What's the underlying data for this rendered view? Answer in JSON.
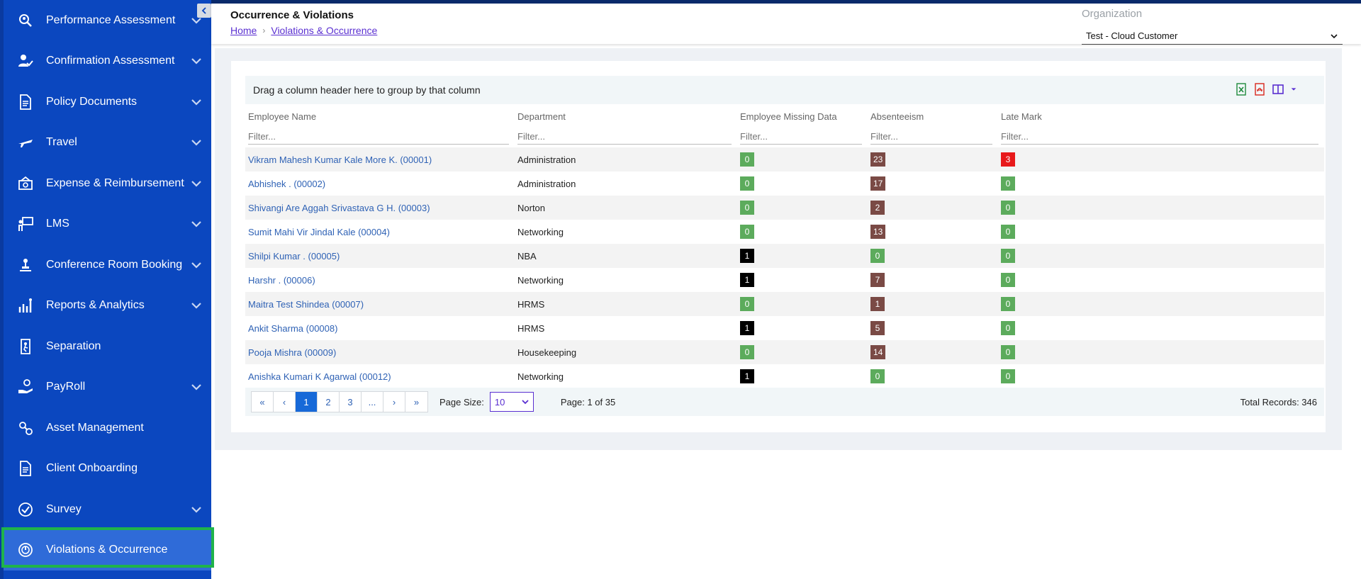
{
  "sidebar": {
    "items": [
      {
        "label": "Performance Assessment",
        "icon": "magnifier-user-icon",
        "chevron": true
      },
      {
        "label": "Confirmation Assessment",
        "icon": "user-check-icon",
        "chevron": true
      },
      {
        "label": "Policy Documents",
        "icon": "document-icon",
        "chevron": true
      },
      {
        "label": "Travel",
        "icon": "airplane-icon",
        "chevron": true
      },
      {
        "label": "Expense & Reimbursement",
        "icon": "money-icon",
        "chevron": true
      },
      {
        "label": "LMS",
        "icon": "teacher-board-icon",
        "chevron": true
      },
      {
        "label": "Conference Room Booking",
        "icon": "conference-icon",
        "chevron": true
      },
      {
        "label": "Reports & Analytics",
        "icon": "analytics-icon",
        "chevron": true
      },
      {
        "label": "Separation",
        "icon": "exit-door-icon",
        "chevron": false
      },
      {
        "label": "PayRoll",
        "icon": "hand-coin-icon",
        "chevron": true
      },
      {
        "label": "Asset Management",
        "icon": "asset-icon",
        "chevron": false
      },
      {
        "label": "Client Onboarding",
        "icon": "document-icon",
        "chevron": false
      },
      {
        "label": "Survey",
        "icon": "check-circle-icon",
        "chevron": true
      },
      {
        "label": "Violations & Occurrence",
        "icon": "violation-icon",
        "chevron": false,
        "active": true
      }
    ]
  },
  "header": {
    "title": "Occurrence & Violations",
    "breadcrumb": [
      "Home",
      "Violations & Occurrence"
    ],
    "org_label": "Organization",
    "org_value": "Test - Cloud Customer"
  },
  "grid": {
    "group_hint": "Drag a column header here to group by that column",
    "columns": [
      "Employee Name",
      "Department",
      "Employee Missing Data",
      "Absenteeism",
      "Late Mark"
    ],
    "filter_placeholder": "Filter...",
    "rows": [
      {
        "name": "Vikram Mahesh Kumar Kale More K. (00001)",
        "dept": "Administration",
        "missing": "0",
        "absent": "23",
        "late": "3",
        "late_color": "#e8191b",
        "missing_color": "#5cab5c"
      },
      {
        "name": "Abhishek . (00002)",
        "dept": "Administration",
        "missing": "0",
        "absent": "17",
        "late": "0",
        "late_color": "#5cab5c",
        "missing_color": "#5cab5c"
      },
      {
        "name": "Shivangi Are Aggah Srivastava G H. (00003)",
        "dept": "Norton",
        "missing": "0",
        "absent": "2",
        "late": "0",
        "late_color": "#5cab5c",
        "missing_color": "#5cab5c"
      },
      {
        "name": "Sumit Mahi Vir Jindal Kale (00004)",
        "dept": "Networking",
        "missing": "0",
        "absent": "13",
        "late": "0",
        "late_color": "#5cab5c",
        "missing_color": "#5cab5c"
      },
      {
        "name": "Shilpi Kumar . (00005)",
        "dept": "NBA",
        "missing": "1",
        "absent": "0",
        "late": "0",
        "late_color": "#5cab5c",
        "missing_color": "#000000"
      },
      {
        "name": "Harshr . (00006)",
        "dept": "Networking",
        "missing": "1",
        "absent": "7",
        "late": "0",
        "late_color": "#5cab5c",
        "missing_color": "#000000"
      },
      {
        "name": "Maitra Test Shindea (00007)",
        "dept": "HRMS",
        "missing": "0",
        "absent": "1",
        "late": "0",
        "late_color": "#5cab5c",
        "missing_color": "#5cab5c"
      },
      {
        "name": "Ankit Sharma (00008)",
        "dept": "HRMS",
        "missing": "1",
        "absent": "5",
        "late": "0",
        "late_color": "#5cab5c",
        "missing_color": "#000000"
      },
      {
        "name": "Pooja Mishra (00009)",
        "dept": "Housekeeping",
        "missing": "0",
        "absent": "14",
        "late": "0",
        "late_color": "#5cab5c",
        "missing_color": "#5cab5c"
      },
      {
        "name": "Anishka Kumari K Agarwal (00012)",
        "dept": "Networking",
        "missing": "1",
        "absent": "0",
        "late": "0",
        "late_color": "#5cab5c",
        "missing_color": "#000000"
      }
    ]
  },
  "colors": {
    "absent_nonzero": "#7a4a45",
    "zero_green": "#5cab5c"
  },
  "pager": {
    "buttons": [
      "«",
      "‹",
      "1",
      "2",
      "3",
      "...",
      "›",
      "»"
    ],
    "active": "1",
    "page_size_label": "Page Size:",
    "page_size": "10",
    "page_info": "Page: 1 of 35",
    "total_records": "Total Records: 346"
  }
}
